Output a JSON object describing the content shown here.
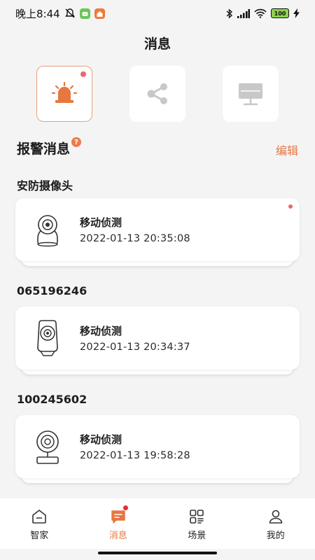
{
  "status_bar": {
    "time": "晚上8:44",
    "battery": "100"
  },
  "page_title": "消息",
  "categories": [
    {
      "icon": "alarm-siren-icon",
      "active": true,
      "unread": true
    },
    {
      "icon": "share-icon",
      "active": false,
      "unread": false
    },
    {
      "icon": "monitor-icon",
      "active": false,
      "unread": false
    }
  ],
  "section": {
    "title": "报警消息",
    "help": "?",
    "edit_label": "编辑"
  },
  "groups": [
    {
      "title": "安防摄像头",
      "event": "移动侦测",
      "time": "2022-01-13 20:35:08",
      "unread": true
    },
    {
      "title": "065196246",
      "event": "移动侦测",
      "time": "2022-01-13 20:34:37",
      "unread": false
    },
    {
      "title": "100245602",
      "event": "移动侦测",
      "time": "2022-01-13 19:58:28",
      "unread": false
    }
  ],
  "nav": [
    {
      "label": "智家"
    },
    {
      "label": "消息"
    },
    {
      "label": "场景"
    },
    {
      "label": "我的"
    }
  ],
  "colors": {
    "accent": "#e8763f",
    "unread_dot": "#e66b6b"
  }
}
